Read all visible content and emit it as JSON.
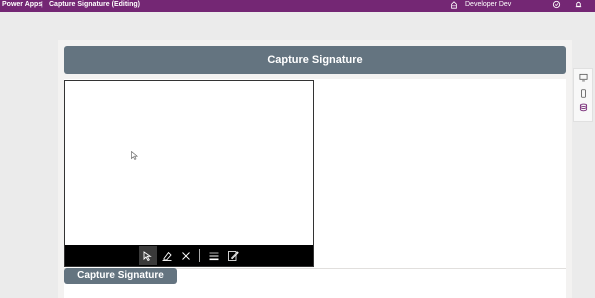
{
  "topbar": {
    "app_name": "Power Apps",
    "separator": "|",
    "document_title": "Capture Signature (Editing)",
    "environment": "Developer Dev"
  },
  "screen": {
    "header_title": "Capture Signature",
    "label_text": "Capture Signature"
  },
  "signature_toolbar": {
    "tools": [
      "select-tool-icon",
      "eraser-icon",
      "clear-icon",
      "line-weight-icon",
      "pen-color-icon"
    ],
    "active_tool": "select-tool-icon"
  },
  "colors": {
    "topbar": "#742774",
    "header": "#647480",
    "toolbar": "#000000"
  }
}
